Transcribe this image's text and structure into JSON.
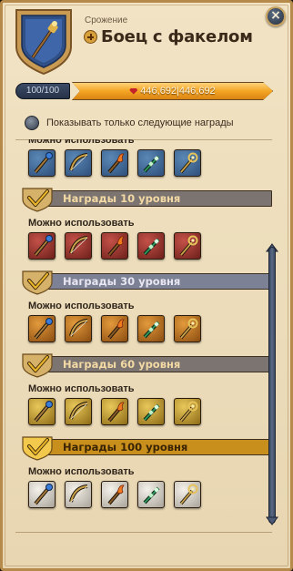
{
  "header": {
    "activity_label": "Срожение",
    "title": "Боец с факелом",
    "close_glyph": "×"
  },
  "progress": {
    "level_text": "100/100",
    "xp_text": "446,692|446,692",
    "xp_fraction": 1.0
  },
  "filter": {
    "label": "Показывать только следующие награды",
    "checked": false
  },
  "sections": [
    {
      "tier_label": null,
      "can_use_label": "Можно использовать",
      "tier_style": "blue",
      "items": [
        "staff-icon",
        "bow-icon",
        "torch-icon",
        "wand-icon",
        "scepter-icon"
      ]
    },
    {
      "tier_label": "Награды 10 уровня",
      "can_use_label": "Можно использовать",
      "tier_style": "red",
      "items": [
        "staff-icon",
        "bow-icon",
        "torch-icon",
        "wand-icon",
        "scepter-icon"
      ]
    },
    {
      "tier_label": "Награды 30 уровня",
      "can_use_label": "Можно использовать",
      "tier_style": "orange",
      "items": [
        "staff-icon",
        "bow-icon",
        "torch-icon",
        "wand-icon",
        "scepter-icon"
      ]
    },
    {
      "tier_label": "Награды 60 уровня",
      "can_use_label": "Можно использовать",
      "tier_style": "gold",
      "items": [
        "staff-icon",
        "bow-icon",
        "torch-icon",
        "wand-icon",
        "scepter-icon"
      ]
    },
    {
      "tier_label": "Награды 100 уровня",
      "can_use_label": "Можно использовать",
      "tier_style": "white",
      "items": [
        "staff-icon",
        "bow-icon",
        "torch-icon",
        "wand-icon",
        "scepter-icon"
      ]
    }
  ],
  "colors": {
    "tier_band_gray": "#7b7470",
    "tier_band_blue": "#7d8196",
    "tier_band_gold": "#c98f1c",
    "tier_text_light": "#f3d9a4",
    "tier_text_dark": "#3a2404",
    "check_gold": "#e8b52a",
    "xp_fill": "#f4a624"
  }
}
